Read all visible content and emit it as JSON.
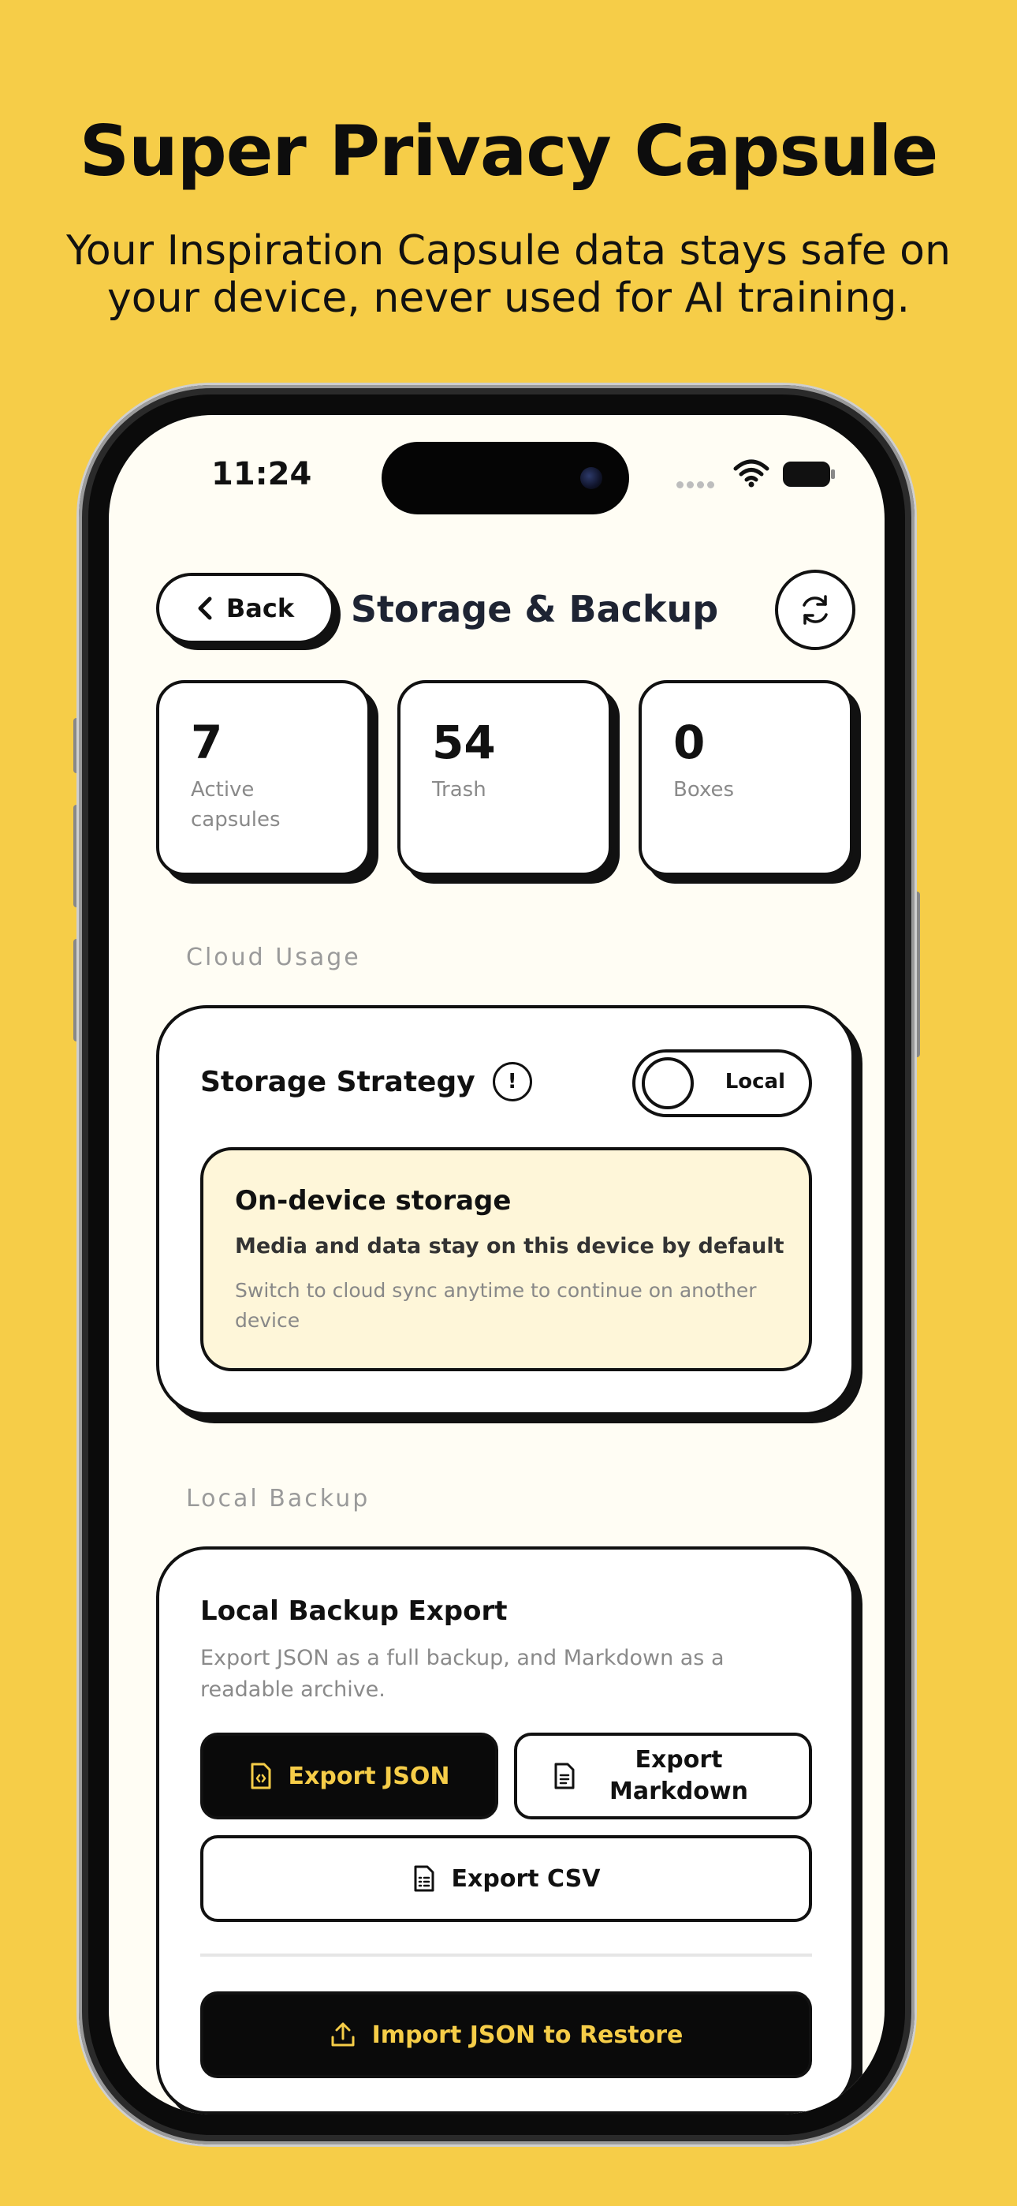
{
  "hero": {
    "title": "Super Privacy Capsule",
    "subtitle_line1": "Your Inspiration Capsule data stays safe on",
    "subtitle_line2": "your device, never used for AI training."
  },
  "status_bar": {
    "time": "11:24"
  },
  "header": {
    "back_label": "Back",
    "title": "Storage & Backup"
  },
  "stats": [
    {
      "value": "7",
      "label": "Active capsules"
    },
    {
      "value": "54",
      "label": "Trash"
    },
    {
      "value": "0",
      "label": "Boxes"
    }
  ],
  "cloud_usage": {
    "section_label": "Cloud Usage",
    "strategy_label": "Storage Strategy",
    "info_glyph": "!",
    "toggle_label": "Local",
    "notice": {
      "title": "On-device storage",
      "line1": "Media and data stay on this device by default",
      "line2": "Switch to cloud sync anytime to continue on another device"
    }
  },
  "local_backup": {
    "section_label": "Local Backup",
    "title": "Local Backup Export",
    "description": "Export JSON as a full backup, and Markdown as a readable archive.",
    "export_json": "Export JSON",
    "export_markdown": "Export Markdown",
    "export_csv": "Export CSV",
    "import_json": "Import JSON to Restore"
  },
  "colors": {
    "background": "#F6CD48",
    "accent_text": "#F6CD48",
    "screen": "#FFFDF4",
    "notice_bg": "#FEF6D9",
    "ink": "#111111"
  },
  "icons": [
    "chevron-left-icon",
    "refresh-icon",
    "info-icon",
    "json-file-icon",
    "document-icon",
    "csv-file-icon",
    "upload-icon",
    "wifi-icon",
    "battery-icon"
  ]
}
